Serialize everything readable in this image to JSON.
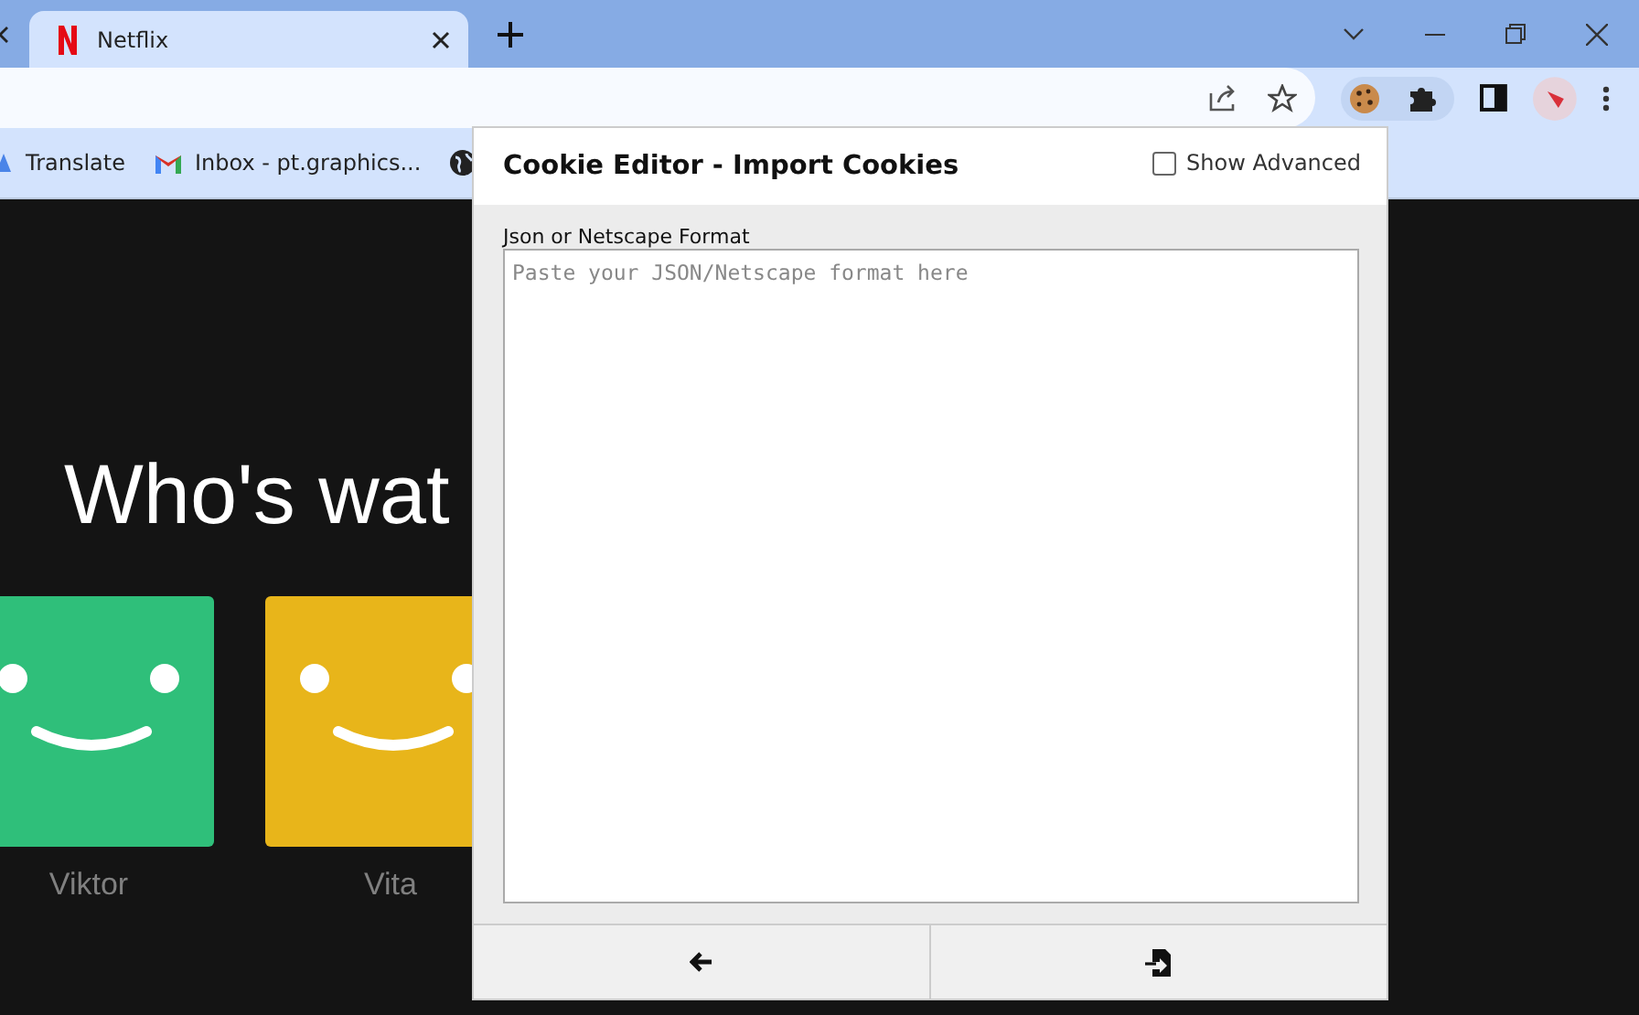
{
  "tabs": [
    {
      "title": "Netflix",
      "selected": true
    }
  ],
  "bookmarks": [
    {
      "label": "Translate",
      "kind": "translate"
    },
    {
      "label": "Inbox - pt.graphics...",
      "kind": "mail"
    },
    {
      "kind": "globe"
    }
  ],
  "page": {
    "heading": "Who's wat",
    "profiles": [
      {
        "name": "Viktor",
        "color": "#2fbf7a"
      },
      {
        "name": "Vita",
        "color": "#e8b51a"
      }
    ]
  },
  "popup": {
    "title": "Cookie Editor - Import Cookies",
    "show_advanced": {
      "label": "Show Advanced",
      "checked": false
    },
    "field_label": "Json or Netscape Format",
    "placeholder": "Paste your JSON/Netscape format here"
  }
}
